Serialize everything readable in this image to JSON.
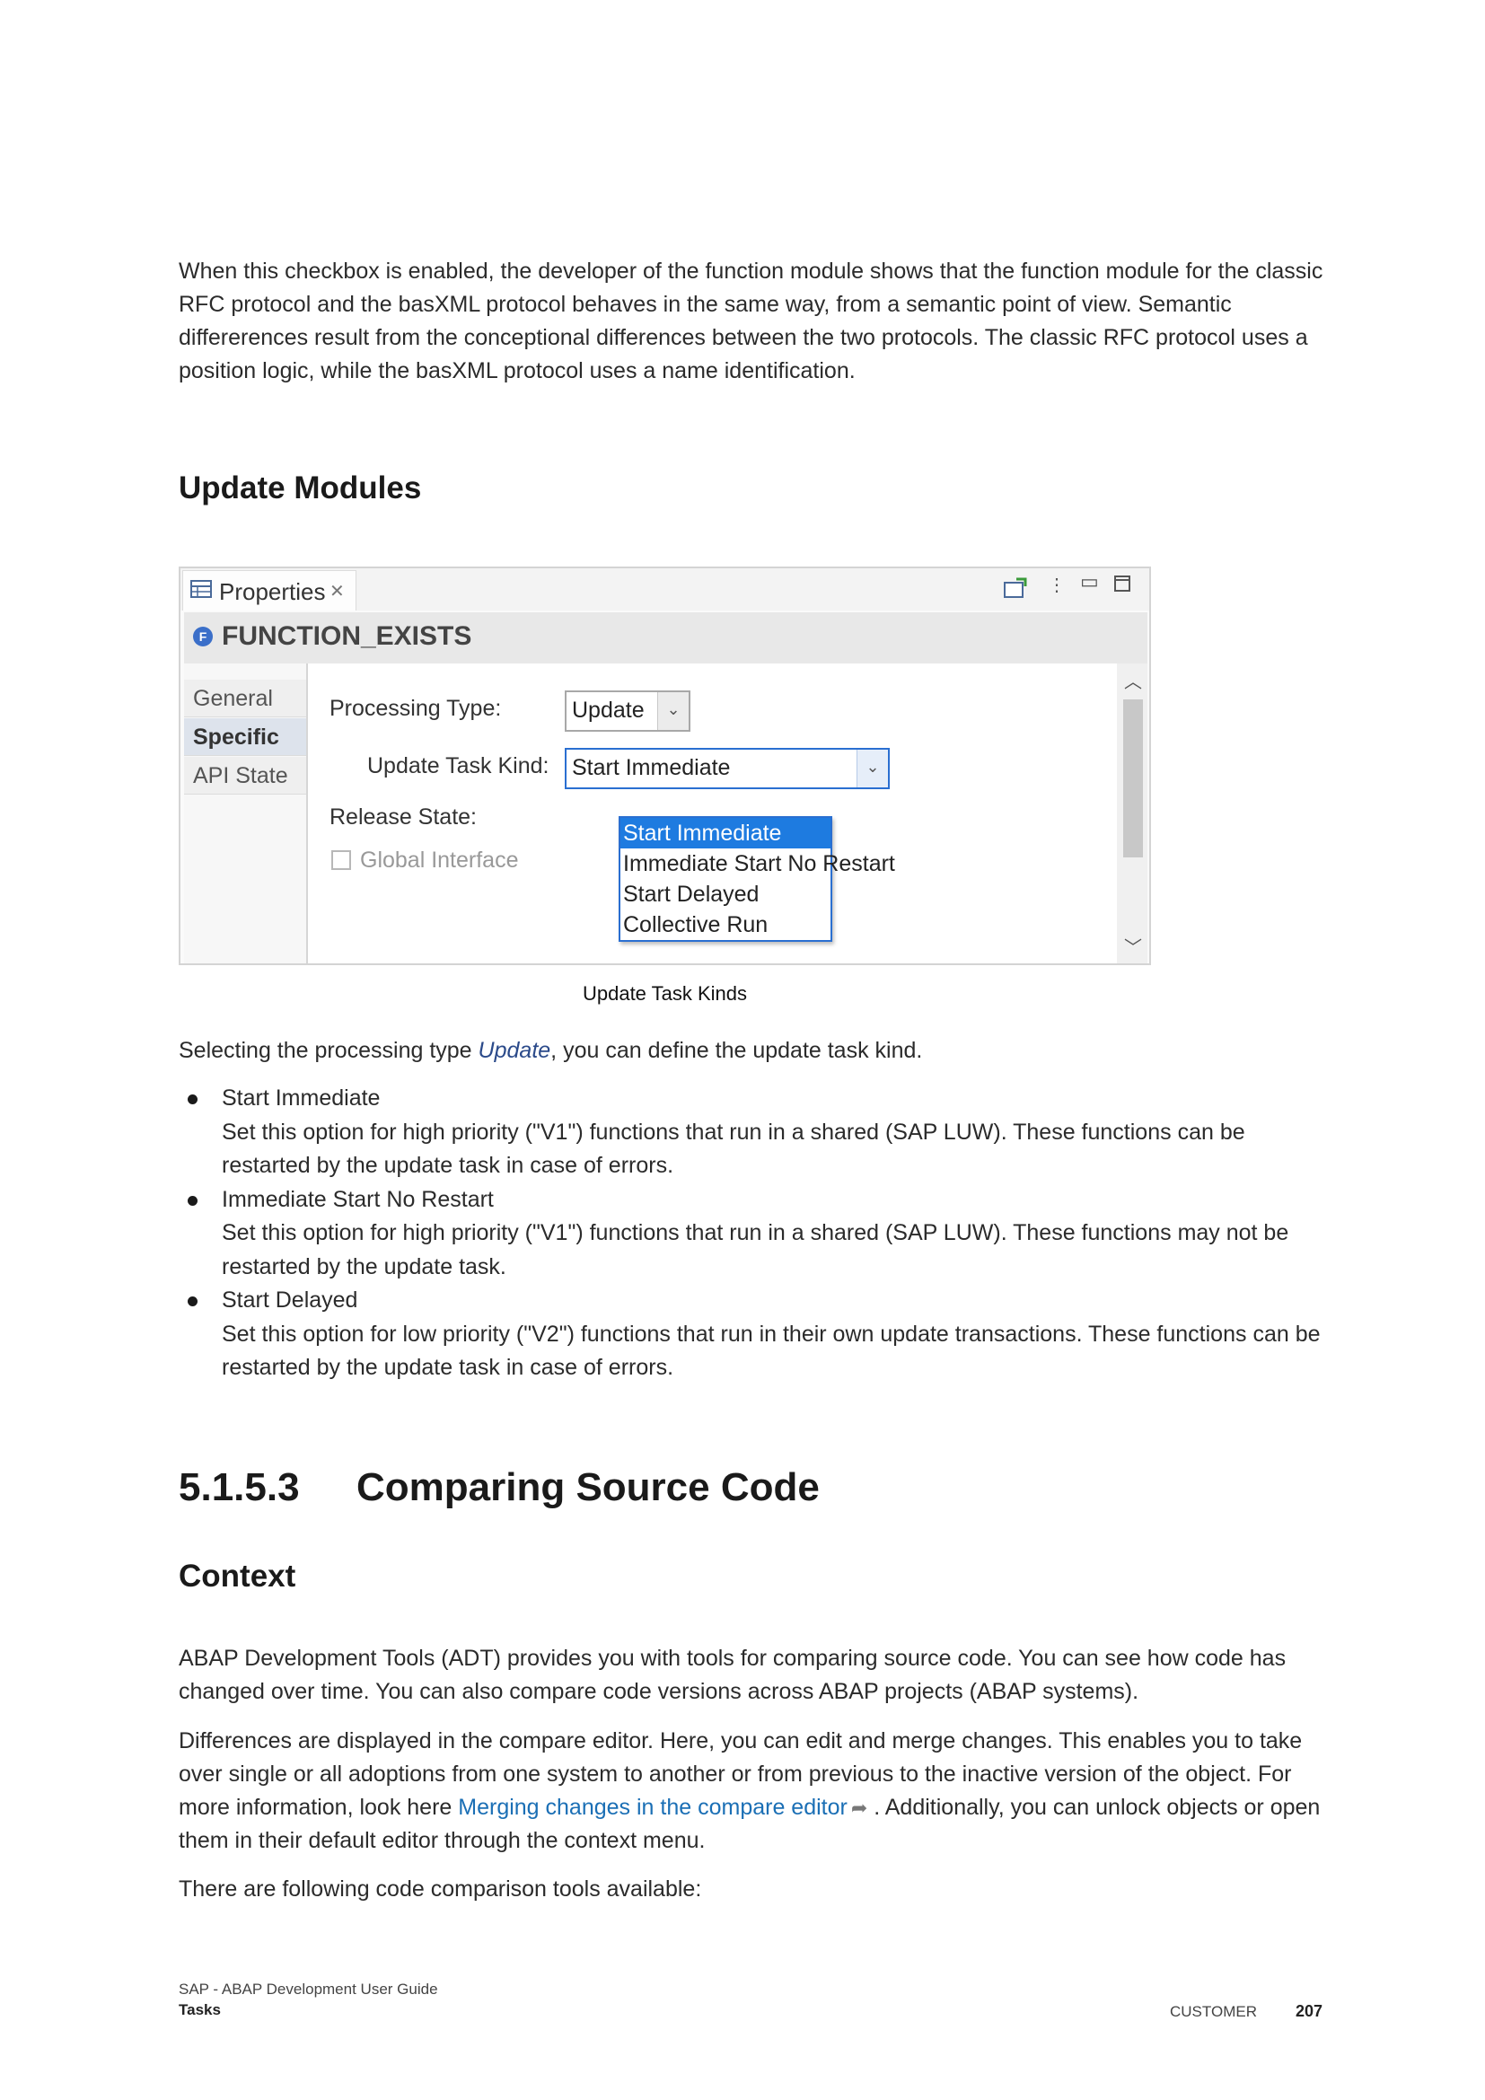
{
  "intro": {
    "text": "When this checkbox is enabled, the developer of the function module shows that the function module for the classic RFC protocol and the basXML protocol behaves in the same way, from a semantic point of view. Semantic differerences result from the conceptional differences between the two protocols. The classic RFC protocol uses a position logic, while the basXML protocol uses a name identification."
  },
  "update_modules": {
    "heading": "Update Modules"
  },
  "figure": {
    "tab_label": "Properties",
    "function_name": "FUNCTION_EXISTS",
    "sidebar_items": [
      "General",
      "Specific",
      "API State"
    ],
    "processing_type_label": "Processing Type:",
    "processing_type_value": "Update",
    "update_task_kind_label": "Update Task Kind:",
    "update_task_kind_value": "Start Immediate",
    "release_state_label": "Release State:",
    "global_interface_label": "Global Interface",
    "dropdown_options": [
      "Start Immediate",
      "Immediate Start No Restart",
      "Start Delayed",
      "Collective Run"
    ],
    "caption": "Update Task Kinds"
  },
  "selection": {
    "prefix": "Selecting the processing type ",
    "emphasis": "Update",
    "suffix": ", you can define the update task kind."
  },
  "bullets": [
    {
      "title": "Start Immediate",
      "description": "Set this option for high priority (\"V1\") functions that run in a shared (SAP LUW). These functions can be restarted by the update task in case of errors."
    },
    {
      "title": "Immediate Start No Restart",
      "description": "Set this option for high priority (\"V1\") functions that run in a shared (SAP LUW). These functions may not be restarted by the update task."
    },
    {
      "title": "Start Delayed",
      "description": "Set this option for low priority (\"V2\") functions that run in their own update transactions. These functions can be restarted by the update task in case of errors."
    }
  ],
  "section": {
    "number": "5.1.5.3",
    "title": "Comparing Source Code",
    "context_heading": "Context",
    "p1": "ABAP Development Tools (ADT) provides you with tools for comparing source code. You can see how code has changed over time. You can also compare code versions across ABAP projects (ABAP systems).",
    "p2_before": "Differences are displayed in the compare editor. Here, you can edit and merge changes. This enables you to take over single or all adoptions from one system to another or from previous to the inactive version of the object. For more information, look here ",
    "p2_link": "Merging changes in the compare editor",
    "p2_after": " . Additionally, you can unlock objects or open them in their default editor through the context menu.",
    "p3": "There are following code comparison tools available:"
  },
  "footer": {
    "doc_title": "SAP - ABAP Development User Guide",
    "chapter": "Tasks",
    "classification": "CUSTOMER",
    "page_number": "207"
  }
}
